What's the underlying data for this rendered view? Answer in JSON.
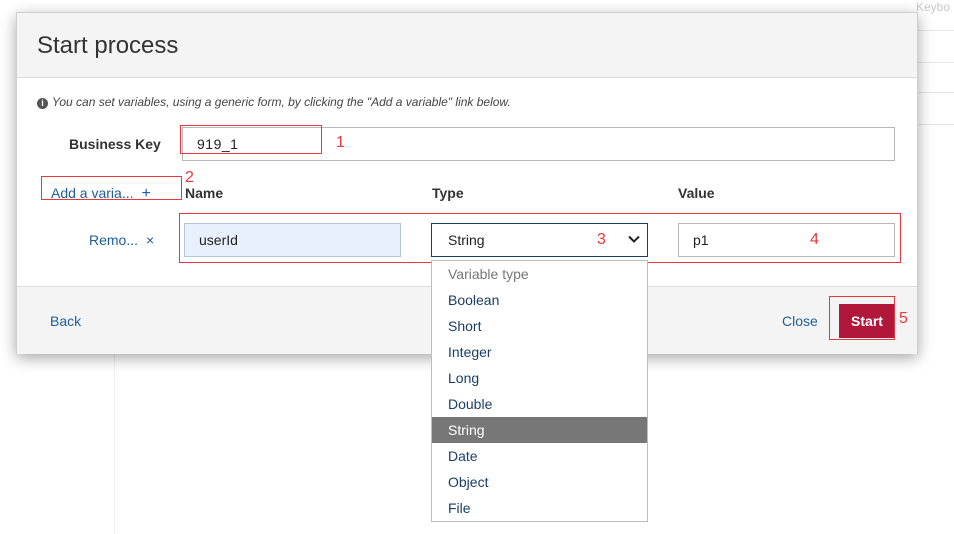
{
  "background": {
    "keyboard_hint": "Keybo"
  },
  "dialog": {
    "title": "Start process",
    "info_text": "You can set variables, using a generic form, by clicking the \"Add a variable\" link below.",
    "business_key": {
      "label": "Business Key",
      "value": "919_1"
    },
    "add_variable_link": "Add a varia...",
    "add_icon": "+",
    "columns": {
      "name": "Name",
      "type": "Type",
      "value": "Value"
    },
    "variable_row": {
      "remove_link": "Remo...",
      "remove_icon": "×",
      "name": "userId",
      "type": "String",
      "value": "p1"
    },
    "footer": {
      "back": "Back",
      "close": "Close",
      "start": "Start"
    }
  },
  "type_dropdown": {
    "header": "Variable type",
    "options": [
      "Boolean",
      "Short",
      "Integer",
      "Long",
      "Double",
      "String",
      "Date",
      "Object",
      "File"
    ],
    "selected": "String"
  },
  "annotations": [
    "1",
    "2",
    "3",
    "4",
    "5"
  ],
  "colors": {
    "accent_link": "#1d5d9b",
    "start_button": "#b0173a",
    "annotation": "#e8383d",
    "selected_option": "#777777"
  }
}
